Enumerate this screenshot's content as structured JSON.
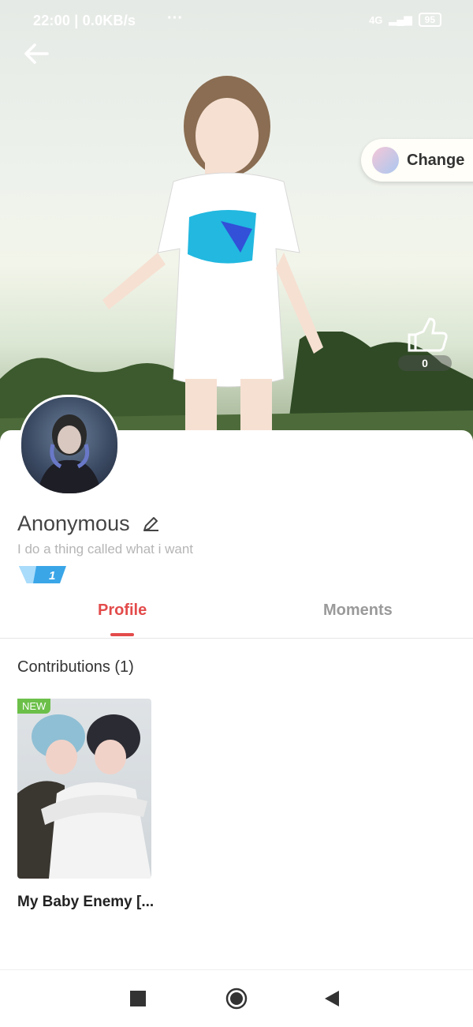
{
  "status_bar": {
    "time_speed": "22:00 | 0.0KB/s",
    "dots": "···",
    "network": "4G",
    "battery": "95"
  },
  "header": {
    "change_button": "Change",
    "like_count": "0"
  },
  "profile": {
    "name": "Anonymous",
    "bio": "I do a thing called what i want",
    "level": "1"
  },
  "tabs": [
    {
      "label": "Profile"
    },
    {
      "label": "Moments"
    }
  ],
  "contributions": {
    "title": "Contributions (1)",
    "items": [
      {
        "badge": "NEW",
        "title": "My Baby Enemy [..."
      }
    ]
  },
  "colors": {
    "accent": "#e34b4b",
    "new_badge": "#6cc04a"
  },
  "icons": [
    "back-arrow-icon",
    "edit-pencil-icon",
    "thumbs-up-icon",
    "nav-square-icon",
    "nav-home-icon",
    "nav-back-icon"
  ]
}
